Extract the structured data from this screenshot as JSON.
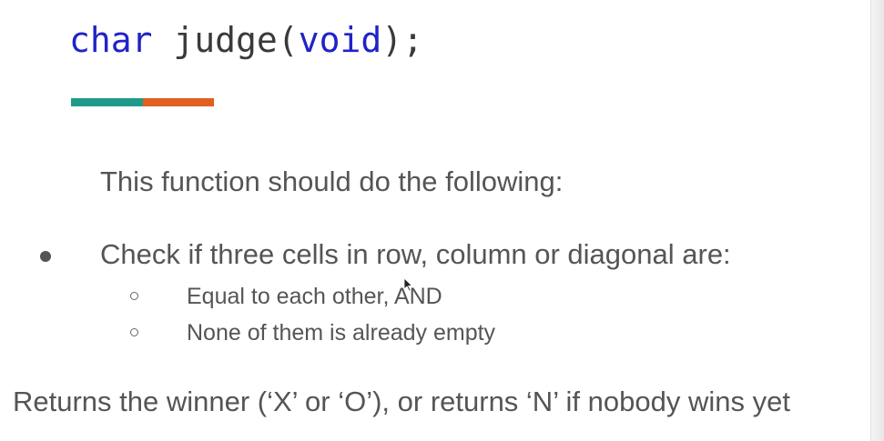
{
  "slide": {
    "title": {
      "type_keyword": "char",
      "space": " ",
      "function_name": "judge(",
      "param_keyword": "void",
      "closing": ");"
    },
    "accent_colors": {
      "left": "#1f9a8a",
      "right": "#e0601e"
    },
    "keyword_color": "#2222c8",
    "intro_text": "This function should do the following:",
    "bullets": [
      {
        "text": "Check if three cells in row, column or diagonal are:",
        "sub_items": [
          "Equal to each other, AND",
          "None of them is already empty"
        ]
      }
    ],
    "returns_text": "Returns the winner (‘X’ or ‘O’), or returns ‘N’ if nobody wins yet"
  }
}
